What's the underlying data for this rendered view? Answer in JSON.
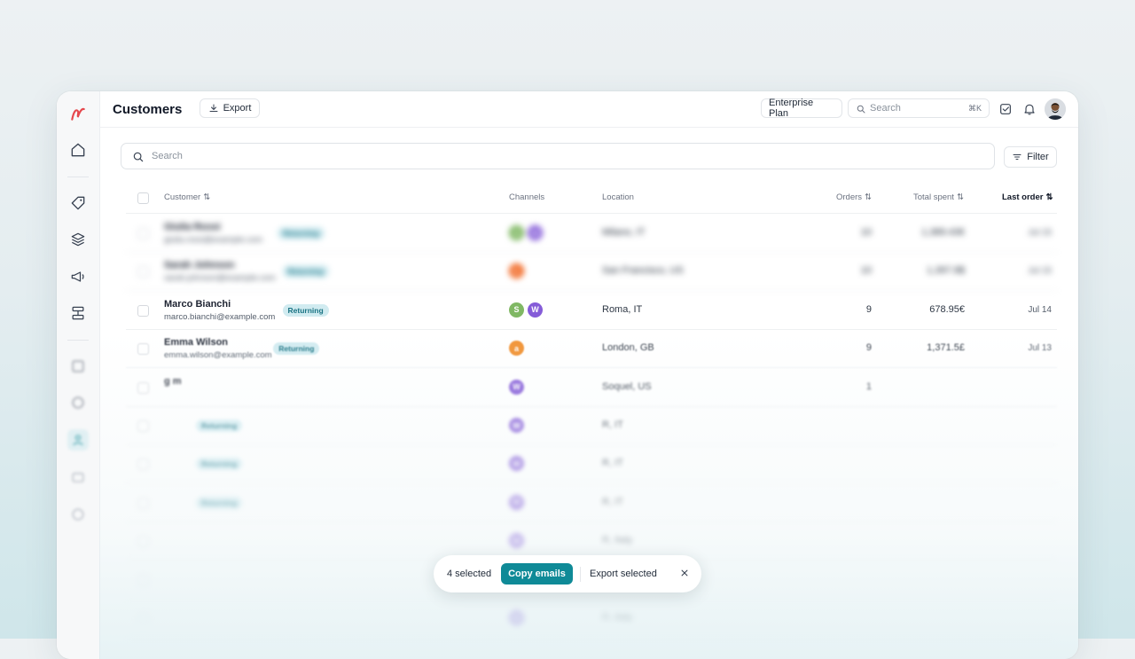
{
  "header": {
    "title": "Customers",
    "export_label": "Export",
    "plan_label": "Enterprise Plan",
    "search_placeholder": "Search",
    "search_shortcut": "⌘K"
  },
  "toolbar": {
    "search_placeholder": "Search",
    "filter_label": "Filter"
  },
  "table": {
    "columns": {
      "customer": "Customer",
      "channels": "Channels",
      "location": "Location",
      "orders": "Orders",
      "total_spent": "Total spent",
      "last_order": "Last order"
    },
    "badge_label": "Returning",
    "rows": [
      {
        "name": "Giulia Rossi",
        "email": "giulia.rossi@example.com",
        "returning": true,
        "channels": [
          "shopify",
          "woocommerce"
        ],
        "location": "Milano, IT",
        "orders": "10",
        "spent": "1,389.43€",
        "last_order": "Jul 15"
      },
      {
        "name": "Sarah Johnson",
        "email": "sarah.johnson@example.com",
        "returning": true,
        "channels": [
          "etsy"
        ],
        "location": "San Francisco, US",
        "orders": "10",
        "spent": "1,397.8$",
        "last_order": "Jul 15"
      },
      {
        "name": "Marco Bianchi",
        "email": "marco.bianchi@example.com",
        "returning": true,
        "channels": [
          "shopify",
          "woocommerce"
        ],
        "location": "Roma, IT",
        "orders": "9",
        "spent": "678.95€",
        "last_order": "Jul 14"
      },
      {
        "name": "Emma Wilson",
        "email": "emma.wilson@example.com",
        "returning": true,
        "channels": [
          "amazon"
        ],
        "location": "London, GB",
        "orders": "9",
        "spent": "1,371.5£",
        "last_order": "Jul 13"
      },
      {
        "name": "g m",
        "email": "",
        "returning": false,
        "channels": [
          "woocommerce"
        ],
        "location": "Soquel, US",
        "orders": "1",
        "spent": "",
        "last_order": ""
      },
      {
        "name": "",
        "email": "",
        "returning": true,
        "channels": [
          "woocommerce"
        ],
        "location": "R, IT",
        "orders": "",
        "spent": "",
        "last_order": ""
      },
      {
        "name": "",
        "email": "",
        "returning": true,
        "channels": [
          "woocommerce"
        ],
        "location": "R, IT",
        "orders": "",
        "spent": "",
        "last_order": ""
      },
      {
        "name": "",
        "email": "",
        "returning": true,
        "channels": [
          "woocommerce"
        ],
        "location": "R, IT",
        "orders": "",
        "spent": "",
        "last_order": ""
      },
      {
        "name": "",
        "email": "",
        "returning": false,
        "channels": [
          "woocommerce"
        ],
        "location": "R, Italy",
        "orders": "",
        "spent": "",
        "last_order": ""
      },
      {
        "name": "",
        "email": "",
        "returning": false,
        "channels": [],
        "location": "",
        "orders": "",
        "spent": "",
        "last_order": ""
      },
      {
        "name": "",
        "email": "",
        "returning": false,
        "channels": [
          "woocommerce"
        ],
        "location": "R, Italy",
        "orders": "",
        "spent": "",
        "last_order": ""
      }
    ]
  },
  "selection": {
    "count_label": "4 selected",
    "copy_label": "Copy emails",
    "export_label": "Export selected"
  },
  "icons": {
    "sidebar": [
      "home-icon",
      "tag-icon",
      "layers-icon",
      "megaphone-icon",
      "workflow-icon",
      "grid-icon",
      "circle-icon",
      "users-icon",
      "box-icon",
      "chart-icon"
    ],
    "header": [
      "download-icon",
      "search-icon",
      "check-square-icon",
      "bell-icon",
      "avatar"
    ]
  },
  "colors": {
    "accent": "#0f8a97",
    "badge_bg": "#cfeaf0",
    "badge_text": "#0f6d7e",
    "brand_logo": "#e5484d",
    "shopify": "#7ab55c",
    "woocommerce": "#7f54d6",
    "etsy": "#f1641e",
    "amazon": "#f08a24"
  }
}
